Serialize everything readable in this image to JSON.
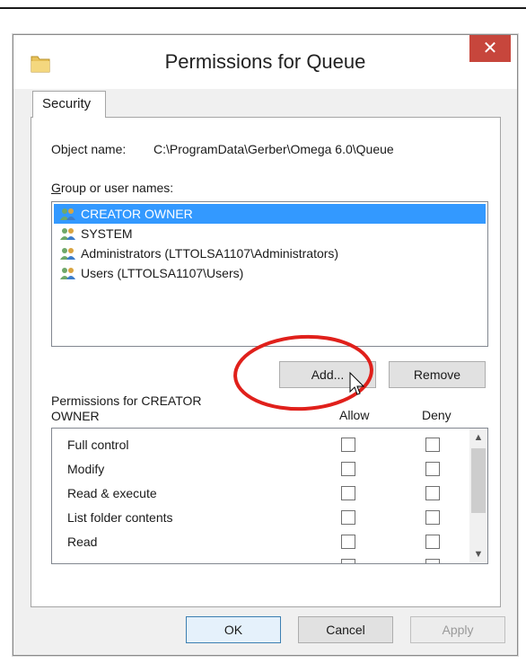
{
  "window": {
    "title": "Permissions for Queue",
    "close_label": "✕"
  },
  "tabs": [
    {
      "label": "Security"
    }
  ],
  "object": {
    "label": "Object name:",
    "value": "C:\\ProgramData\\Gerber\\Omega 6.0\\Queue"
  },
  "group_section": {
    "label_underlined": "G",
    "label_rest": "roup or user names:",
    "users": [
      {
        "name": "CREATOR OWNER",
        "selected": true
      },
      {
        "name": "SYSTEM",
        "selected": false
      },
      {
        "name": "Administrators (LTTOLSA1107\\Administrators)",
        "selected": false
      },
      {
        "name": "Users (LTTOLSA1107\\Users)",
        "selected": false
      }
    ]
  },
  "buttons": {
    "add": "Add...",
    "remove": "Remove",
    "ok": "OK",
    "cancel": "Cancel",
    "apply": "Apply"
  },
  "permissions": {
    "label": "Permissions for CREATOR OWNER",
    "allow_header": "Allow",
    "deny_header": "Deny",
    "rows": [
      {
        "name": "Full control",
        "allow": false,
        "deny": false
      },
      {
        "name": "Modify",
        "allow": false,
        "deny": false
      },
      {
        "name": "Read & execute",
        "allow": false,
        "deny": false
      },
      {
        "name": "List folder contents",
        "allow": false,
        "deny": false
      },
      {
        "name": "Read",
        "allow": false,
        "deny": false
      }
    ]
  },
  "colors": {
    "selection": "#3399ff",
    "close_button": "#c7463c",
    "annotation": "#e0201b"
  },
  "icons": {
    "window": "folder-icon",
    "user": "users-group-icon",
    "scroll_up": "chevron-up-icon",
    "scroll_down": "chevron-down-icon",
    "pointer": "mouse-cursor-icon"
  }
}
